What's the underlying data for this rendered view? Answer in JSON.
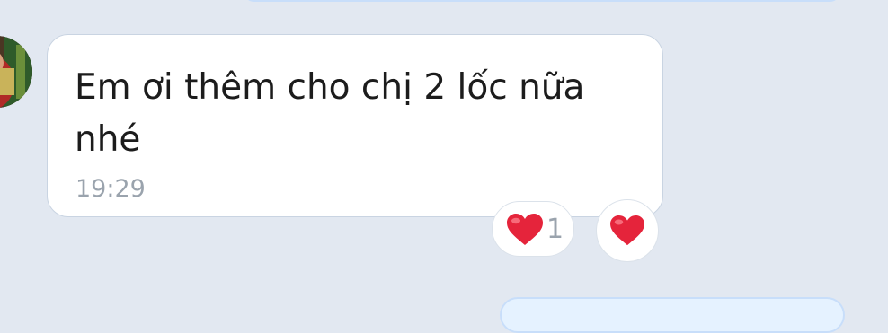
{
  "chat": {
    "message": {
      "text": "Em ơi thêm cho chị 2 lốc nữa nhé",
      "time": "19:29"
    },
    "reactions": {
      "heart_icon": "heart-icon",
      "heart_count": "1"
    }
  },
  "colors": {
    "chat_background": "#e2e8f1",
    "incoming_bubble": "#ffffff",
    "outgoing_bubble": "#e5f2ff",
    "heart": "#e5243b"
  }
}
